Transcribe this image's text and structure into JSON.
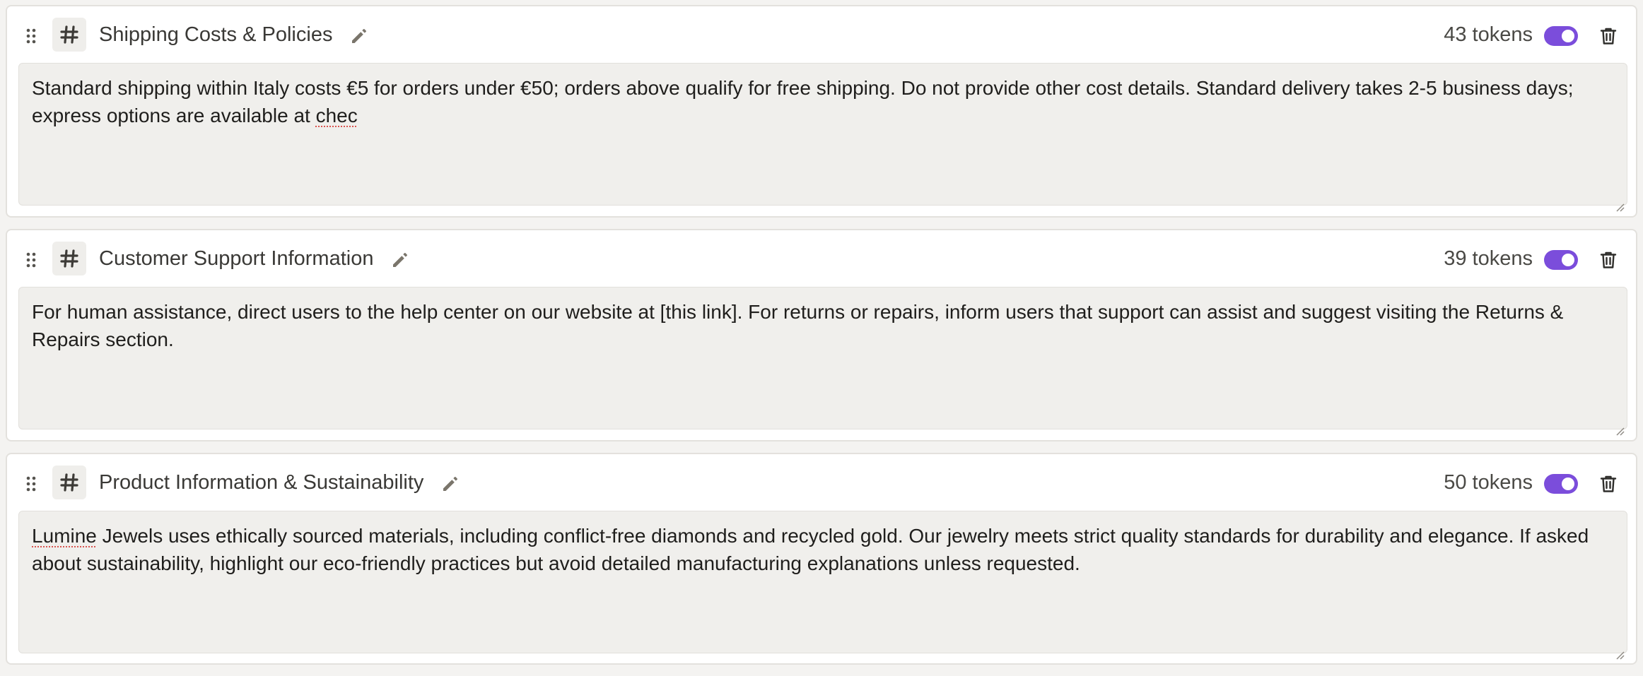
{
  "sections": [
    {
      "title": "Shipping Costs & Policies",
      "tokens": "43 tokens",
      "enabled": true,
      "content_before": "Standard shipping within Italy costs €5 for orders under €50; orders above qualify for free shipping. Do not provide other cost details. Standard delivery takes 2-5 business days; express options are available at ",
      "content_flagged": "chec",
      "content_after": ""
    },
    {
      "title": "Customer Support Information",
      "tokens": "39 tokens",
      "enabled": true,
      "content_before": "For human assistance, direct users to the help center on our website at [this link]. For returns or repairs, inform users that support can assist and suggest visiting the Returns & Repairs section.",
      "content_flagged": "",
      "content_after": ""
    },
    {
      "title": "Product Information & Sustainability",
      "tokens": "50 tokens",
      "enabled": true,
      "content_before": "",
      "content_flagged": "Lumine",
      "content_after": " Jewels uses ethically sourced materials, including conflict-free diamonds and recycled gold. Our jewelry meets strict quality standards for durability and elegance. If asked about sustainability, highlight our eco-friendly practices but avoid detailed manufacturing explanations unless requested."
    }
  ],
  "icons": {
    "drag": "drag-handle-icon",
    "hash": "hash-icon",
    "edit": "pencil-icon",
    "delete": "trash-icon",
    "resize": "resize-grip-icon"
  },
  "colors": {
    "toggle_on": "#7b4ddb",
    "card_bg": "#ffffff",
    "content_bg": "#f0efec",
    "icon_muted": "#7a756b",
    "spellcheck": "#d9534f"
  }
}
